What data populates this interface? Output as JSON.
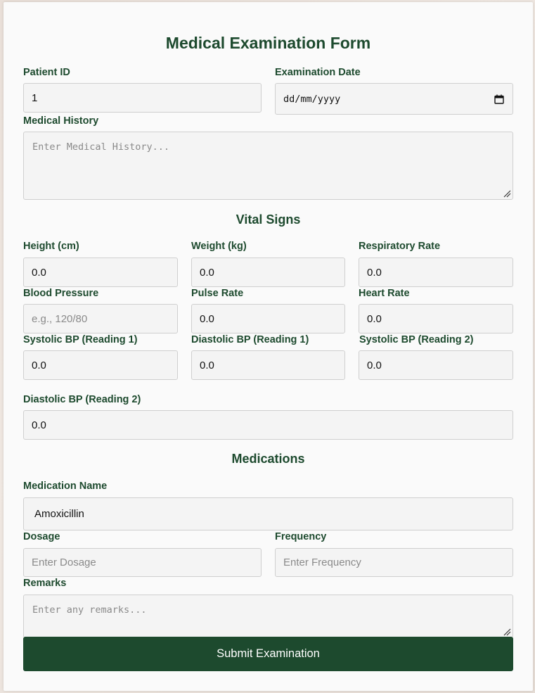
{
  "form": {
    "title": "Medical Examination Form",
    "patient_id": {
      "label": "Patient ID",
      "value": "1"
    },
    "exam_date": {
      "label": "Examination Date",
      "value": "dd/mm/yyyy"
    },
    "medical_history": {
      "label": "Medical History",
      "placeholder": "Enter Medical History..."
    },
    "vital_signs_title": "Vital Signs",
    "vitals": {
      "height": {
        "label": "Height (cm)",
        "value": "0.0"
      },
      "weight": {
        "label": "Weight (kg)",
        "value": "0.0"
      },
      "respiratory_rate": {
        "label": "Respiratory Rate",
        "value": "0.0"
      },
      "blood_pressure": {
        "label": "Blood Pressure",
        "placeholder": "e.g., 120/80"
      },
      "pulse_rate": {
        "label": "Pulse Rate",
        "value": "0.0"
      },
      "heart_rate": {
        "label": "Heart Rate",
        "value": "0.0"
      },
      "systolic_1": {
        "label": "Systolic BP (Reading 1)",
        "value": "0.0"
      },
      "diastolic_1": {
        "label": "Diastolic BP (Reading 1)",
        "value": "0.0"
      },
      "systolic_2": {
        "label": "Systolic BP (Reading 2)",
        "value": "0.0"
      },
      "diastolic_2": {
        "label": "Diastolic BP (Reading 2)",
        "value": "0.0"
      }
    },
    "medications_title": "Medications",
    "medications": {
      "name": {
        "label": "Medication Name",
        "value": "Amoxicillin"
      },
      "dosage": {
        "label": "Dosage",
        "placeholder": "Enter Dosage"
      },
      "frequency": {
        "label": "Frequency",
        "placeholder": "Enter Frequency"
      }
    },
    "remarks": {
      "label": "Remarks",
      "placeholder": "Enter any remarks..."
    },
    "submit_label": "Submit Examination",
    "colors": {
      "primary": "#1d4a2e",
      "field_bg": "#f4f4f4",
      "border": "#cfcfcf"
    }
  }
}
